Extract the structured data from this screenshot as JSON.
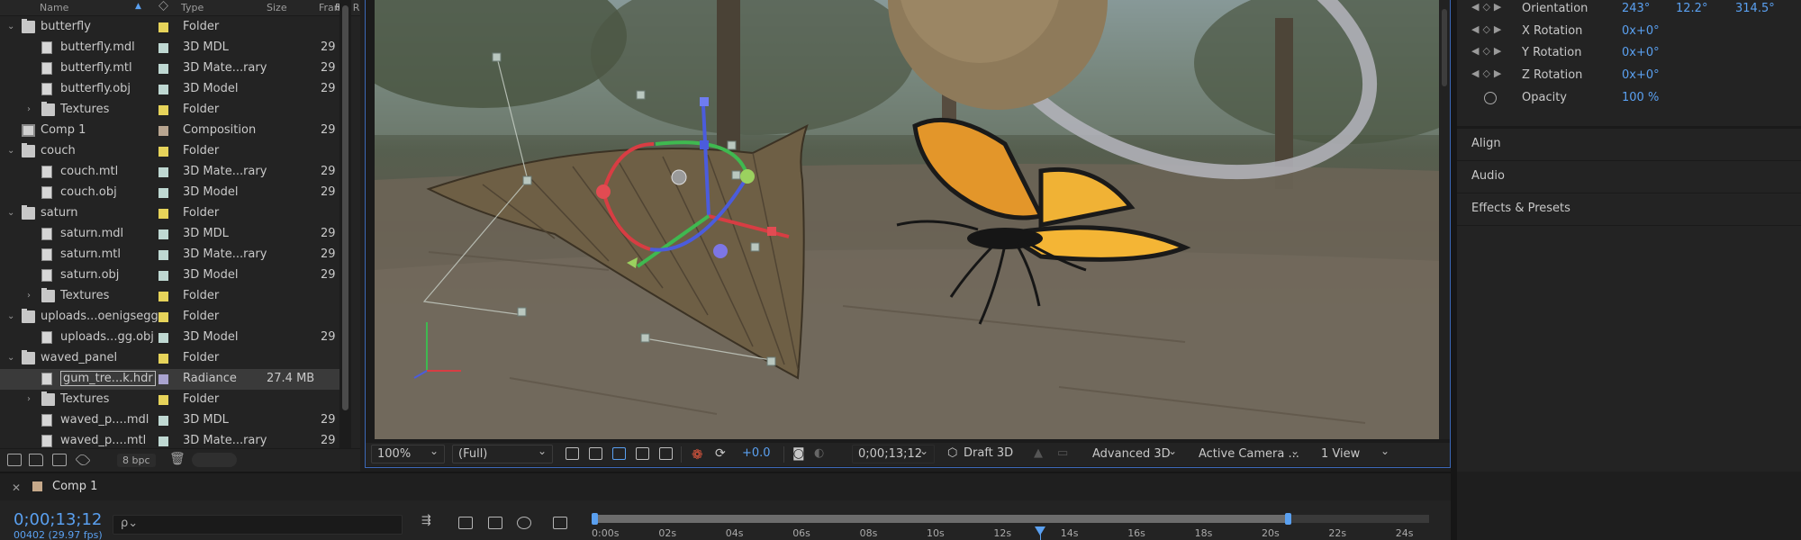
{
  "project": {
    "columns": {
      "name": "Name",
      "type": "Type",
      "size": "Size",
      "frame": "Frame R"
    },
    "items": [
      {
        "indent": 0,
        "twirl": "open",
        "icon": "folder-icon",
        "name": "butterfly",
        "label_color": "#e6d35a",
        "type": "Folder",
        "size": "",
        "frame": ""
      },
      {
        "indent": 1,
        "twirl": "",
        "icon": "file-icon",
        "name": "butterfly.mdl",
        "label_color": "#bfd8d2",
        "type": "3D MDL",
        "size": "",
        "frame": "29"
      },
      {
        "indent": 1,
        "twirl": "",
        "icon": "file-icon",
        "name": "butterfly.mtl",
        "label_color": "#bfd8d2",
        "type": "3D Mate...rary",
        "size": "",
        "frame": "29"
      },
      {
        "indent": 1,
        "twirl": "",
        "icon": "file-icon",
        "name": "butterfly.obj",
        "label_color": "#bfd8d2",
        "type": "3D Model",
        "size": "",
        "frame": "29"
      },
      {
        "indent": 1,
        "twirl": "closed",
        "icon": "folder-icon",
        "name": "Textures",
        "label_color": "#e6d35a",
        "type": "Folder",
        "size": "",
        "frame": ""
      },
      {
        "indent": 0,
        "twirl": "",
        "icon": "composition-icon",
        "name": "Comp 1",
        "label_color": "#b8a590",
        "type": "Composition",
        "size": "",
        "frame": "29"
      },
      {
        "indent": 0,
        "twirl": "open",
        "icon": "folder-icon",
        "name": "couch",
        "label_color": "#e6d35a",
        "type": "Folder",
        "size": "",
        "frame": ""
      },
      {
        "indent": 1,
        "twirl": "",
        "icon": "file-icon",
        "name": "couch.mtl",
        "label_color": "#bfd8d2",
        "type": "3D Mate...rary",
        "size": "",
        "frame": "29"
      },
      {
        "indent": 1,
        "twirl": "",
        "icon": "file-icon",
        "name": "couch.obj",
        "label_color": "#bfd8d2",
        "type": "3D Model",
        "size": "",
        "frame": "29"
      },
      {
        "indent": 0,
        "twirl": "open",
        "icon": "folder-icon",
        "name": "saturn",
        "label_color": "#e6d35a",
        "type": "Folder",
        "size": "",
        "frame": ""
      },
      {
        "indent": 1,
        "twirl": "",
        "icon": "file-icon",
        "name": "saturn.mdl",
        "label_color": "#bfd8d2",
        "type": "3D MDL",
        "size": "",
        "frame": "29"
      },
      {
        "indent": 1,
        "twirl": "",
        "icon": "file-icon",
        "name": "saturn.mtl",
        "label_color": "#bfd8d2",
        "type": "3D Mate...rary",
        "size": "",
        "frame": "29"
      },
      {
        "indent": 1,
        "twirl": "",
        "icon": "file-icon",
        "name": "saturn.obj",
        "label_color": "#bfd8d2",
        "type": "3D Model",
        "size": "",
        "frame": "29"
      },
      {
        "indent": 1,
        "twirl": "closed",
        "icon": "folder-icon",
        "name": "Textures",
        "label_color": "#e6d35a",
        "type": "Folder",
        "size": "",
        "frame": ""
      },
      {
        "indent": 0,
        "twirl": "open",
        "icon": "folder-icon",
        "name": "uploads...oenigsegg",
        "label_color": "#e6d35a",
        "type": "Folder",
        "size": "",
        "frame": ""
      },
      {
        "indent": 1,
        "twirl": "",
        "icon": "file-icon",
        "name": "uploads...gg.obj",
        "label_color": "#bfd8d2",
        "type": "3D Model",
        "size": "",
        "frame": "29"
      },
      {
        "indent": 0,
        "twirl": "open",
        "icon": "folder-icon",
        "name": "waved_panel",
        "label_color": "#e6d35a",
        "type": "Folder",
        "size": "",
        "frame": ""
      },
      {
        "indent": 1,
        "twirl": "",
        "icon": "file-icon",
        "name": "gum_tre...k.hdr",
        "label_color": "#a9a3cf",
        "type": "Radiance",
        "size": "27.4 MB",
        "frame": "",
        "selected": true
      },
      {
        "indent": 1,
        "twirl": "closed",
        "icon": "folder-icon",
        "name": "Textures",
        "label_color": "#e6d35a",
        "type": "Folder",
        "size": "",
        "frame": ""
      },
      {
        "indent": 1,
        "twirl": "",
        "icon": "file-icon",
        "name": "waved_p....mdl",
        "label_color": "#bfd8d2",
        "type": "3D MDL",
        "size": "",
        "frame": "29"
      },
      {
        "indent": 1,
        "twirl": "",
        "icon": "file-icon",
        "name": "waved_p....mtl",
        "label_color": "#bfd8d2",
        "type": "3D Mate...rary",
        "size": "",
        "frame": "29"
      }
    ],
    "footer": {
      "bpc": "8 bpc"
    }
  },
  "viewer": {
    "zoom": "100%",
    "resolution": "(Full)",
    "exposure": "+0.0",
    "timecode": "0;00;13;12",
    "draft": "Draft 3D",
    "renderer": "Advanced 3D",
    "camera": "Active Camera ...",
    "views": "1 View"
  },
  "properties": {
    "transform": [
      {
        "label": "Orientation",
        "values": [
          "243°",
          "12.2°",
          "314.5°"
        ]
      },
      {
        "label": "X Rotation",
        "values": [
          "0x+0°"
        ]
      },
      {
        "label": "Y Rotation",
        "values": [
          "0x+0°"
        ]
      },
      {
        "label": "Z Rotation",
        "values": [
          "0x+0°"
        ]
      }
    ],
    "opacity": {
      "label": "Opacity",
      "value": "100 %"
    },
    "sections": [
      "Align",
      "Audio",
      "Effects & Presets"
    ]
  },
  "timeline": {
    "tab": "Comp 1",
    "timecode": "0;00;13;12",
    "frame_info": "00402 (29.97 fps)",
    "search_placeholder": "ρ⌄",
    "ticks": [
      "0:00s",
      "02s",
      "04s",
      "06s",
      "08s",
      "10s",
      "12s",
      "14s",
      "16s",
      "18s",
      "20s",
      "22s",
      "24s"
    ],
    "playhead_seconds": 13.4,
    "work_area_end_seconds": 20.8,
    "duration_seconds": 25
  },
  "colors": {
    "accent": "#5aa0f0",
    "panel": "#232323",
    "selection_border": "#3c68b8"
  }
}
